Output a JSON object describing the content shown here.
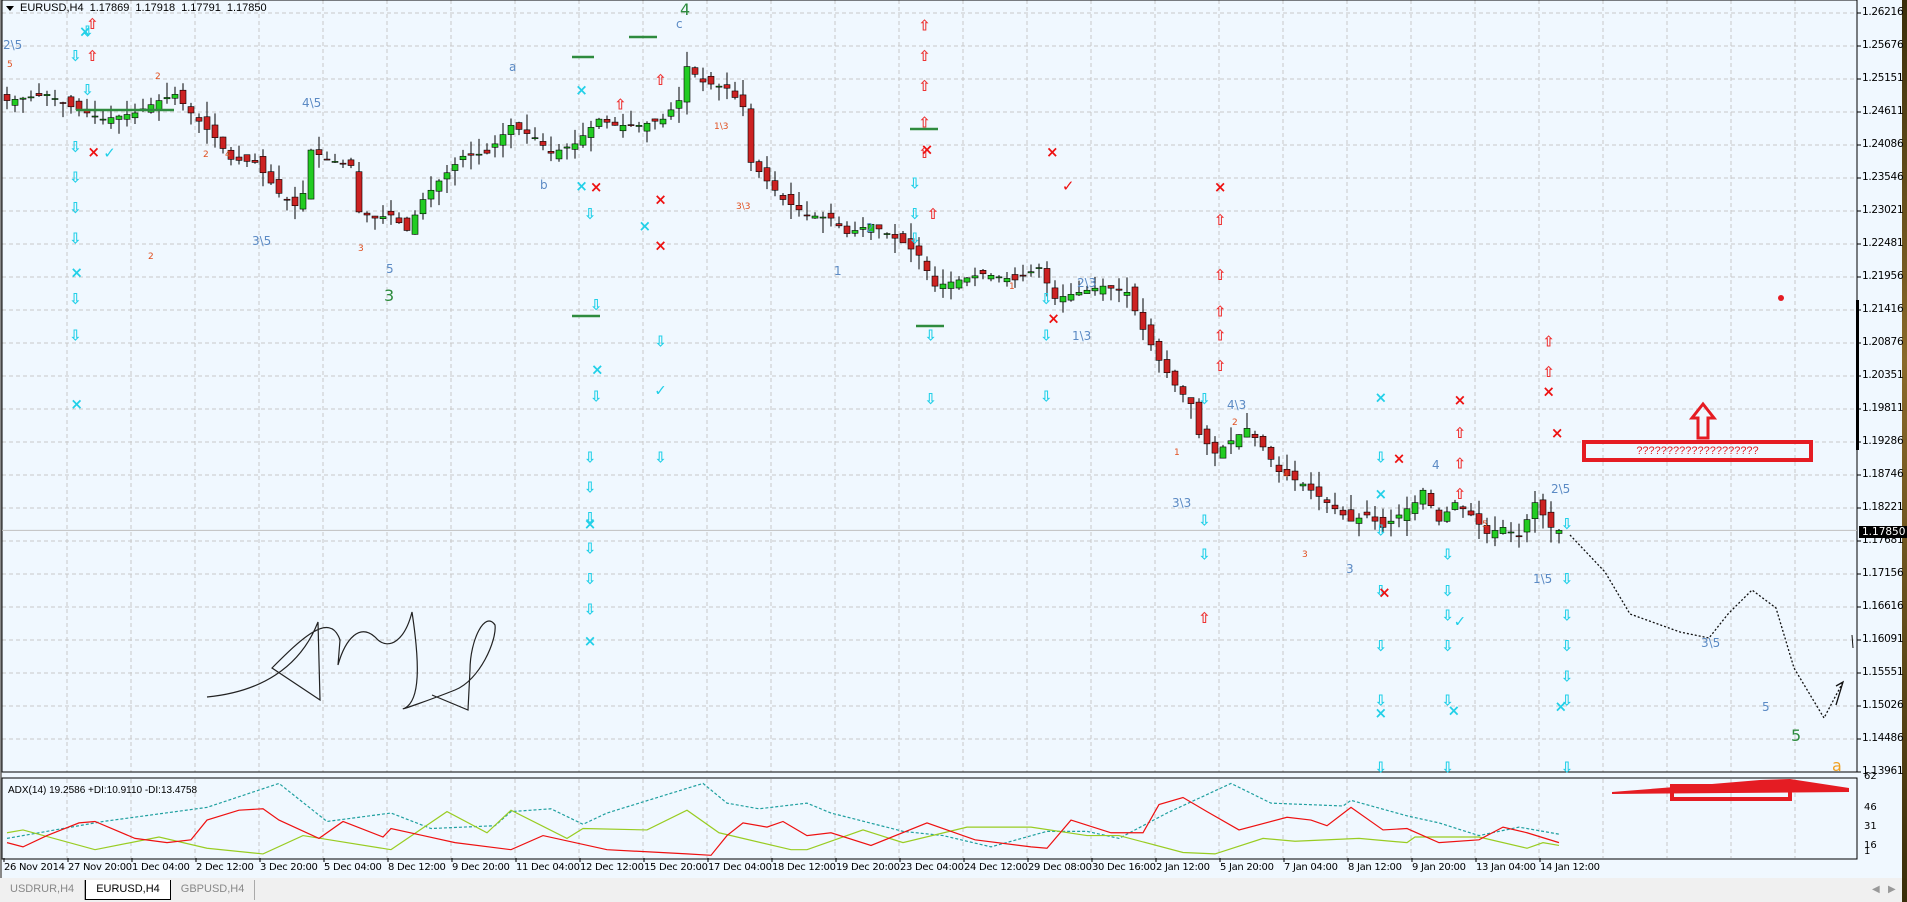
{
  "header": {
    "symbol": "EURUSD,H4",
    "open": "1.17869",
    "high": "1.17918",
    "low": "1.17791",
    "close": "1.17850"
  },
  "price_axis": [
    "1.26216",
    "1.25676",
    "1.25151",
    "1.24611",
    "1.24086",
    "1.23546",
    "1.23021",
    "1.22481",
    "1.21956",
    "1.21416",
    "1.20876",
    "1.20351",
    "1.19811",
    "1.19286",
    "1.18746",
    "1.18221",
    "1.17681",
    "1.17156",
    "1.16616",
    "1.16091",
    "1.15551",
    "1.15026",
    "1.14486",
    "1.13961"
  ],
  "current_price": "1.17850",
  "time_axis": [
    "26 Nov 2014",
    "27 Nov 20:00",
    "1 Dec 04:00",
    "2 Dec 12:00",
    "3 Dec 20:00",
    "5 Dec 04:00",
    "8 Dec 12:00",
    "9 Dec 20:00",
    "11 Dec 04:00",
    "12 Dec 12:00",
    "15 Dec 20:00",
    "17 Dec 04:00",
    "18 Dec 12:00",
    "19 Dec 20:00",
    "23 Dec 04:00",
    "24 Dec 12:00",
    "29 Dec 08:00",
    "30 Dec 16:00",
    "2 Jan 12:00",
    "5 Jan 20:00",
    "7 Jan 04:00",
    "8 Jan 12:00",
    "9 Jan 20:00",
    "13 Jan 04:00",
    "14 Jan 12:00"
  ],
  "adx": {
    "label": "ADX(14) 19.2586 +DI:10.9110 -DI:13.4758",
    "ticks": [
      "62",
      "46",
      "31",
      "16",
      "1"
    ]
  },
  "annotations": [
    "2\\5",
    "4\\5",
    "a",
    "b",
    "c",
    "4",
    "3\\5",
    "5",
    "3",
    "2",
    "1",
    "2\\3",
    "1\\3",
    "4\\3",
    "3\\3",
    "4",
    "3",
    "2\\5",
    "1\\5",
    "3\\5",
    "5",
    "5",
    "a",
    "1\\3",
    "3\\3",
    "2",
    "4",
    "2",
    "1",
    "3",
    "5",
    "1",
    "4",
    "2",
    "5",
    "3",
    "2"
  ],
  "question_box": "????????????????????",
  "tabs": [
    "USDRUR,H4",
    "EURUSD,H4",
    "GBPUSD,H4"
  ],
  "colors": {
    "bull": "#22cc22",
    "bear": "#cc2222",
    "adx": "#20a0a0",
    "plus_di": "#99cc22",
    "minus_di": "#ee1111",
    "grid": "#c8c8c8"
  },
  "chart_data": {
    "type": "candlestick",
    "title": "EURUSD,H4",
    "ylim": [
      1.13961,
      1.26216
    ],
    "close_anchors": [
      [
        0,
        1.248
      ],
      [
        5,
        1.249
      ],
      [
        8,
        1.247
      ],
      [
        12,
        1.245
      ],
      [
        16,
        1.246
      ],
      [
        19,
        1.248
      ],
      [
        21,
        1.249
      ],
      [
        23,
        1.246
      ],
      [
        26,
        1.242
      ],
      [
        28,
        1.2385
      ],
      [
        31,
        1.238
      ],
      [
        34,
        1.233
      ],
      [
        36,
        1.231
      ],
      [
        37,
        1.233
      ],
      [
        38,
        1.24
      ],
      [
        40,
        1.2385
      ],
      [
        43,
        1.2375
      ],
      [
        44,
        1.23
      ],
      [
        46,
        1.229
      ],
      [
        48,
        1.2295
      ],
      [
        50,
        1.227
      ],
      [
        52,
        1.232
      ],
      [
        54,
        1.235
      ],
      [
        57,
        1.239
      ],
      [
        60,
        1.2395
      ],
      [
        63,
        1.244
      ],
      [
        66,
        1.242
      ],
      [
        68,
        1.2395
      ],
      [
        71,
        1.241
      ],
      [
        74,
        1.245
      ],
      [
        76,
        1.244
      ],
      [
        79,
        1.244
      ],
      [
        82,
        1.245
      ],
      [
        84,
        1.248
      ],
      [
        85,
        1.2535
      ],
      [
        87,
        1.251
      ],
      [
        90,
        1.25
      ],
      [
        92,
        1.247
      ],
      [
        93,
        1.238
      ],
      [
        95,
        1.235
      ],
      [
        97,
        1.232
      ],
      [
        100,
        1.2295
      ],
      [
        103,
        1.229
      ],
      [
        105,
        1.2265
      ],
      [
        108,
        1.228
      ],
      [
        112,
        1.225
      ],
      [
        114,
        1.223
      ],
      [
        116,
        1.218
      ],
      [
        119,
        1.219
      ],
      [
        122,
        1.22
      ],
      [
        126,
        1.219
      ],
      [
        129,
        1.221
      ],
      [
        131,
        1.216
      ],
      [
        134,
        1.217
      ],
      [
        137,
        1.218
      ],
      [
        140,
        1.217
      ],
      [
        142,
        1.211
      ],
      [
        144,
        1.206
      ],
      [
        146,
        1.202
      ],
      [
        148,
        1.199
      ],
      [
        149,
        1.194
      ],
      [
        151,
        1.191
      ],
      [
        153,
        1.193
      ],
      [
        155,
        1.195
      ],
      [
        157,
        1.192
      ],
      [
        159,
        1.188
      ],
      [
        162,
        1.186
      ],
      [
        164,
        1.184
      ],
      [
        166,
        1.182
      ],
      [
        168,
        1.18
      ],
      [
        170,
        1.181
      ],
      [
        172,
        1.179
      ],
      [
        174,
        1.181
      ],
      [
        176,
        1.183
      ],
      [
        177,
        1.185
      ],
      [
        179,
        1.18
      ],
      [
        181,
        1.183
      ],
      [
        183,
        1.181
      ],
      [
        185,
        1.178
      ],
      [
        187,
        1.179
      ],
      [
        189,
        1.1775
      ],
      [
        191,
        1.183
      ],
      [
        193,
        1.179
      ],
      [
        194,
        1.1785
      ]
    ],
    "adx_series": [
      {
        "name": "ADX",
        "values": [
          [
            0,
            22
          ],
          [
            12,
            34
          ],
          [
            25,
            44
          ],
          [
            34,
            61
          ],
          [
            40,
            34
          ],
          [
            48,
            40
          ],
          [
            53,
            29
          ],
          [
            61,
            31
          ],
          [
            63,
            41
          ],
          [
            68,
            43
          ],
          [
            72,
            32
          ],
          [
            75,
            40
          ],
          [
            87,
            61
          ],
          [
            90,
            47
          ],
          [
            94,
            43
          ],
          [
            100,
            47
          ],
          [
            103,
            40
          ],
          [
            112,
            27
          ],
          [
            117,
            24
          ],
          [
            123,
            16
          ],
          [
            130,
            27
          ],
          [
            135,
            27
          ],
          [
            139,
            22
          ],
          [
            145,
            40
          ],
          [
            153,
            61
          ],
          [
            158,
            47
          ],
          [
            167,
            45
          ],
          [
            168,
            49
          ],
          [
            175,
            38
          ],
          [
            179,
            33
          ],
          [
            184,
            24
          ],
          [
            189,
            30
          ],
          [
            194,
            25
          ]
        ]
      },
      {
        "name": "+DI",
        "values": [
          [
            0,
            26
          ],
          [
            2,
            28
          ],
          [
            11,
            14
          ],
          [
            19,
            23
          ],
          [
            25,
            15
          ],
          [
            32,
            11
          ],
          [
            37,
            24
          ],
          [
            48,
            14
          ],
          [
            55,
            41
          ],
          [
            60,
            26
          ],
          [
            63,
            42
          ],
          [
            70,
            22
          ],
          [
            72,
            29
          ],
          [
            80,
            28
          ],
          [
            85,
            42
          ],
          [
            89,
            26
          ],
          [
            98,
            14
          ],
          [
            100,
            14
          ],
          [
            107,
            28
          ],
          [
            112,
            19
          ],
          [
            120,
            30
          ],
          [
            128,
            30
          ],
          [
            135,
            24
          ],
          [
            139,
            24
          ],
          [
            147,
            12
          ],
          [
            151,
            11
          ],
          [
            157,
            22
          ],
          [
            161,
            20
          ],
          [
            169,
            22
          ],
          [
            175,
            19
          ],
          [
            176,
            23
          ],
          [
            184,
            23
          ],
          [
            190,
            15
          ],
          [
            192,
            19
          ],
          [
            194,
            17
          ]
        ]
      },
      {
        "name": "-DI",
        "values": [
          [
            0,
            19
          ],
          [
            2,
            16
          ],
          [
            5,
            24
          ],
          [
            9,
            33
          ],
          [
            11,
            34
          ],
          [
            16,
            22
          ],
          [
            20,
            19
          ],
          [
            23,
            21
          ],
          [
            25,
            35
          ],
          [
            29,
            42
          ],
          [
            32,
            43
          ],
          [
            34,
            35
          ],
          [
            39,
            22
          ],
          [
            42,
            34
          ],
          [
            47,
            23
          ],
          [
            48,
            29
          ],
          [
            52,
            24
          ],
          [
            56,
            19
          ],
          [
            63,
            14
          ],
          [
            67,
            24
          ],
          [
            75,
            14
          ],
          [
            85,
            11
          ],
          [
            88,
            10
          ],
          [
            90,
            24
          ],
          [
            92,
            33
          ],
          [
            95,
            30
          ],
          [
            97,
            34
          ],
          [
            100,
            24
          ],
          [
            103,
            26
          ],
          [
            108,
            17
          ],
          [
            115,
            33
          ],
          [
            121,
            21
          ],
          [
            128,
            16
          ],
          [
            130,
            15
          ],
          [
            133,
            35
          ],
          [
            138,
            26
          ],
          [
            142,
            26
          ],
          [
            144,
            46
          ],
          [
            147,
            51
          ],
          [
            150,
            41
          ],
          [
            154,
            28
          ],
          [
            160,
            37
          ],
          [
            163,
            35
          ],
          [
            165,
            31
          ],
          [
            168,
            44
          ],
          [
            172,
            28
          ],
          [
            175,
            29
          ],
          [
            179,
            19
          ],
          [
            184,
            21
          ],
          [
            187,
            30
          ],
          [
            190,
            26
          ],
          [
            194,
            19
          ]
        ]
      }
    ]
  }
}
